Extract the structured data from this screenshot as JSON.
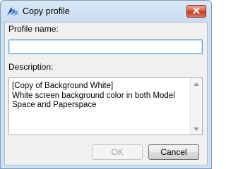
{
  "window": {
    "title": "Copy profile",
    "app_icon": "bricscad-logo-icon",
    "close_icon": "close-icon"
  },
  "form": {
    "profile_label": "Profile name:",
    "profile_value": "",
    "description_label": "Description:",
    "description_value": "[Copy of Background White]\nWhite screen background color in both Model Space and Paperspace"
  },
  "buttons": {
    "ok_label": "OK",
    "cancel_label": "Cancel"
  },
  "colors": {
    "accent": "#c2391f",
    "focus_border": "#5b9fd6"
  }
}
